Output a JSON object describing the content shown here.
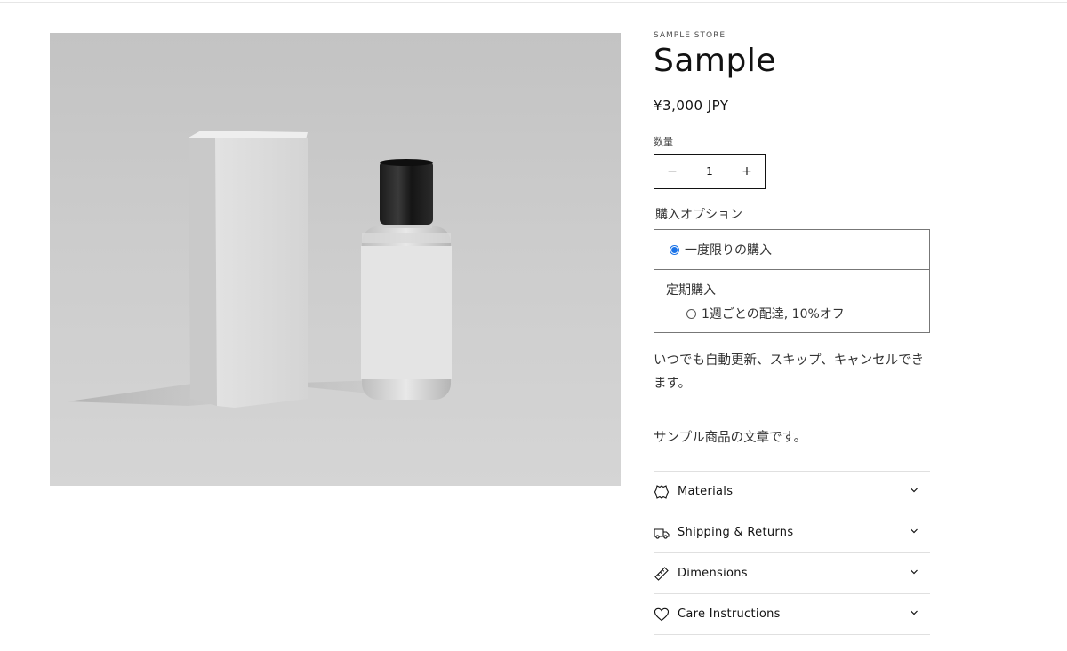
{
  "product": {
    "vendor": "SAMPLE STORE",
    "title": "Sample",
    "price": "¥3,000 JPY",
    "image_alt": "product-image-bottle-and-box"
  },
  "quantity": {
    "label": "数量",
    "value": "1",
    "minus": "−",
    "plus": "+"
  },
  "purchase_options": {
    "label": "購入オプション",
    "one_time": "一度限りの購入",
    "subscription_heading": "定期購入",
    "subscription_option": "1週ごとの配達, 10%オフ",
    "selected": "one_time"
  },
  "note": "いつでも自動更新、スキップ、キャンセルできます。",
  "description": "サンプル商品の文章です。",
  "accordion": [
    {
      "title": "Materials",
      "icon": "leather-icon"
    },
    {
      "title": "Shipping & Returns",
      "icon": "truck-icon"
    },
    {
      "title": "Dimensions",
      "icon": "ruler-icon"
    },
    {
      "title": "Care Instructions",
      "icon": "heart-icon"
    }
  ],
  "colors": {
    "accent": "#1a73e8",
    "text": "#121212"
  }
}
